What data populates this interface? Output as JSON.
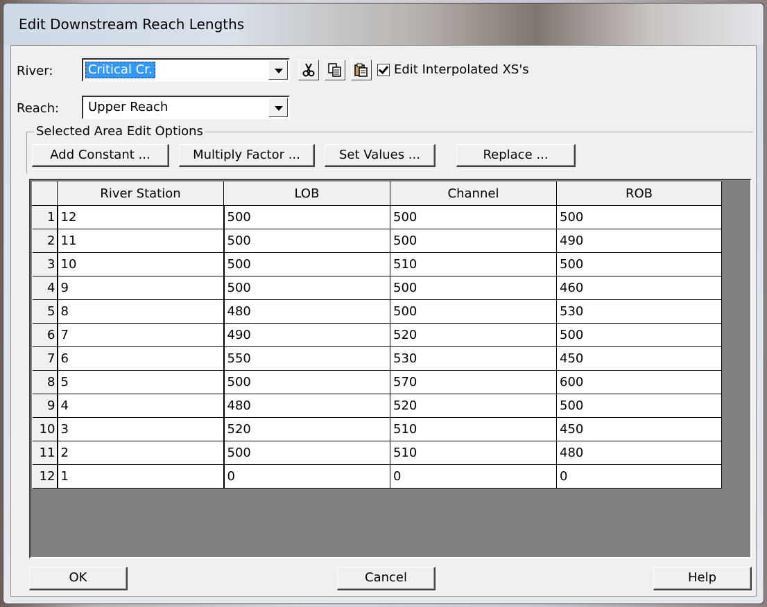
{
  "window": {
    "title": "Edit Downstream Reach Lengths"
  },
  "river": {
    "label": "River:",
    "value": "Critical Cr."
  },
  "reach": {
    "label": "Reach:",
    "value": "Upper Reach"
  },
  "toolbar": {
    "cut_icon": "scissors-icon",
    "copy_icon": "copy-icon",
    "paste_icon": "paste-icon"
  },
  "interp": {
    "label": "Edit Interpolated XS's",
    "checked": true
  },
  "options": {
    "legend": "Selected Area Edit Options",
    "add_constant": "Add Constant ...",
    "multiply_factor": "Multiply Factor ...",
    "set_values": "Set Values ...",
    "replace": "Replace ..."
  },
  "table": {
    "headers": [
      "",
      "River Station",
      "LOB",
      "Channel",
      "ROB"
    ],
    "rows": [
      [
        "1",
        "12",
        "500",
        "500",
        "500"
      ],
      [
        "2",
        "11",
        "500",
        "500",
        "490"
      ],
      [
        "3",
        "10",
        "500",
        "510",
        "500"
      ],
      [
        "4",
        "9",
        "500",
        "500",
        "460"
      ],
      [
        "5",
        "8",
        "480",
        "500",
        "530"
      ],
      [
        "6",
        "7",
        "490",
        "520",
        "500"
      ],
      [
        "7",
        "6",
        "550",
        "530",
        "450"
      ],
      [
        "8",
        "5",
        "500",
        "570",
        "600"
      ],
      [
        "9",
        "4",
        "480",
        "520",
        "500"
      ],
      [
        "10",
        "3",
        "520",
        "510",
        "450"
      ],
      [
        "11",
        "2",
        "500",
        "510",
        "480"
      ],
      [
        "12",
        "1",
        "0",
        "0",
        "0"
      ]
    ]
  },
  "footer": {
    "ok": "OK",
    "cancel": "Cancel",
    "help": "Help"
  }
}
